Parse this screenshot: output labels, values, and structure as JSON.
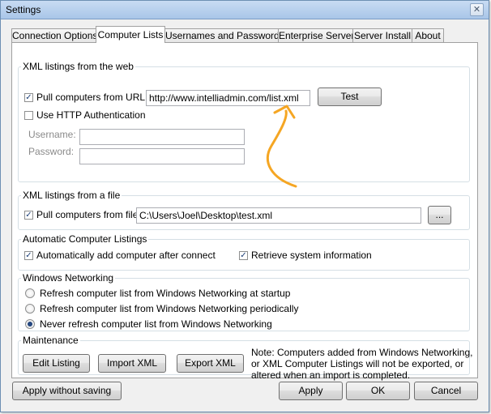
{
  "window": {
    "title": "Settings",
    "close_glyph": "✕"
  },
  "tabs": [
    {
      "label": "Connection Options"
    },
    {
      "label": "Computer Lists"
    },
    {
      "label": "Usernames and Passwords"
    },
    {
      "label": "Enterprise Server"
    },
    {
      "label": "Server Install"
    },
    {
      "label": "About"
    }
  ],
  "active_tab": "Computer Lists",
  "xml_web": {
    "legend": "XML listings from the web",
    "pull_label": "Pull computers from URL:",
    "pull_checked": true,
    "url_value": "http://www.intelliadmin.com/list.xml",
    "test_label": "Test",
    "http_auth_label": "Use HTTP Authentication",
    "http_auth_checked": false,
    "username_label": "Username:",
    "username_value": "",
    "password_label": "Password:",
    "password_value": ""
  },
  "xml_file": {
    "legend": "XML listings from a file",
    "pull_label": "Pull computers from file:",
    "pull_checked": true,
    "path_value": "C:\\Users\\Joel\\Desktop\\test.xml",
    "browse_label": "..."
  },
  "auto": {
    "legend": "Automatic Computer Listings",
    "add_label": "Automatically add computer after connect",
    "add_checked": true,
    "retrieve_label": "Retrieve system information",
    "retrieve_checked": true
  },
  "networking": {
    "legend": "Windows Networking",
    "options": [
      {
        "label": "Refresh computer list from Windows Networking at startup",
        "selected": false
      },
      {
        "label": "Refresh computer list from Windows Networking periodically",
        "selected": false
      },
      {
        "label": "Never refresh computer list from Windows Networking",
        "selected": true
      }
    ]
  },
  "maintenance": {
    "legend": "Maintenance",
    "edit_label": "Edit Listing",
    "import_label": "Import XML",
    "export_label": "Export XML",
    "note_lines": [
      "Note: Computers added from Windows Networking,",
      "or XML Computer Listings will not be exported, or",
      "altered when an import is completed."
    ]
  },
  "footer": {
    "apply_without_saving": "Apply without saving",
    "apply": "Apply",
    "ok": "OK",
    "cancel": "Cancel"
  },
  "checkmark_glyph": "✓",
  "colors": {
    "annotation_arrow": "#f5a623",
    "title_bar": "#b9d1ee"
  }
}
